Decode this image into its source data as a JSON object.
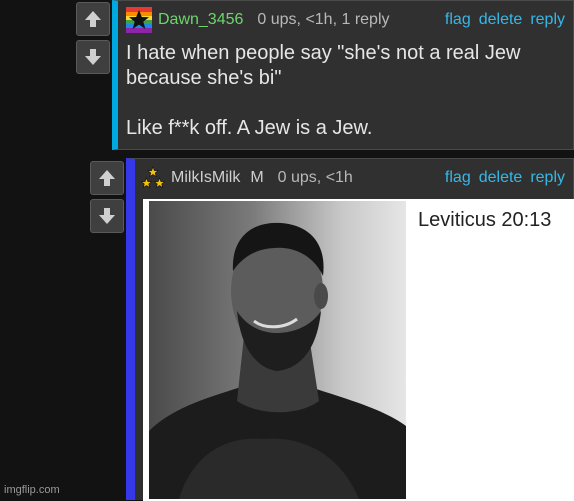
{
  "comments": [
    {
      "username": "Dawn_3456",
      "meta": "0 ups, <1h, 1 reply",
      "actions": {
        "flag": "flag",
        "delete": "delete",
        "reply": "reply"
      },
      "body": [
        "I hate when people say \"she's not a real Jew because she's bi\"",
        "Like f**k off. A Jew is a Jew."
      ],
      "icons": {
        "avatar": "rainbow-star-icon",
        "upvote": "arrow-up-icon",
        "downvote": "arrow-down-icon"
      },
      "accent_color": "#00a8e0",
      "username_color": "#6dd66d"
    },
    {
      "username": "MilkIsMilk",
      "badge": "M",
      "meta": "0 ups, <1h",
      "actions": {
        "flag": "flag",
        "delete": "delete",
        "reply": "reply"
      },
      "image_caption": "Leviticus 20:13",
      "icons": {
        "avatar": "three-stars-icon",
        "upvote": "arrow-up-icon",
        "downvote": "arrow-down-icon"
      },
      "accent_color": "#3538e8"
    }
  ],
  "watermark": "imgflip.com",
  "link_color": "#35b8e8"
}
